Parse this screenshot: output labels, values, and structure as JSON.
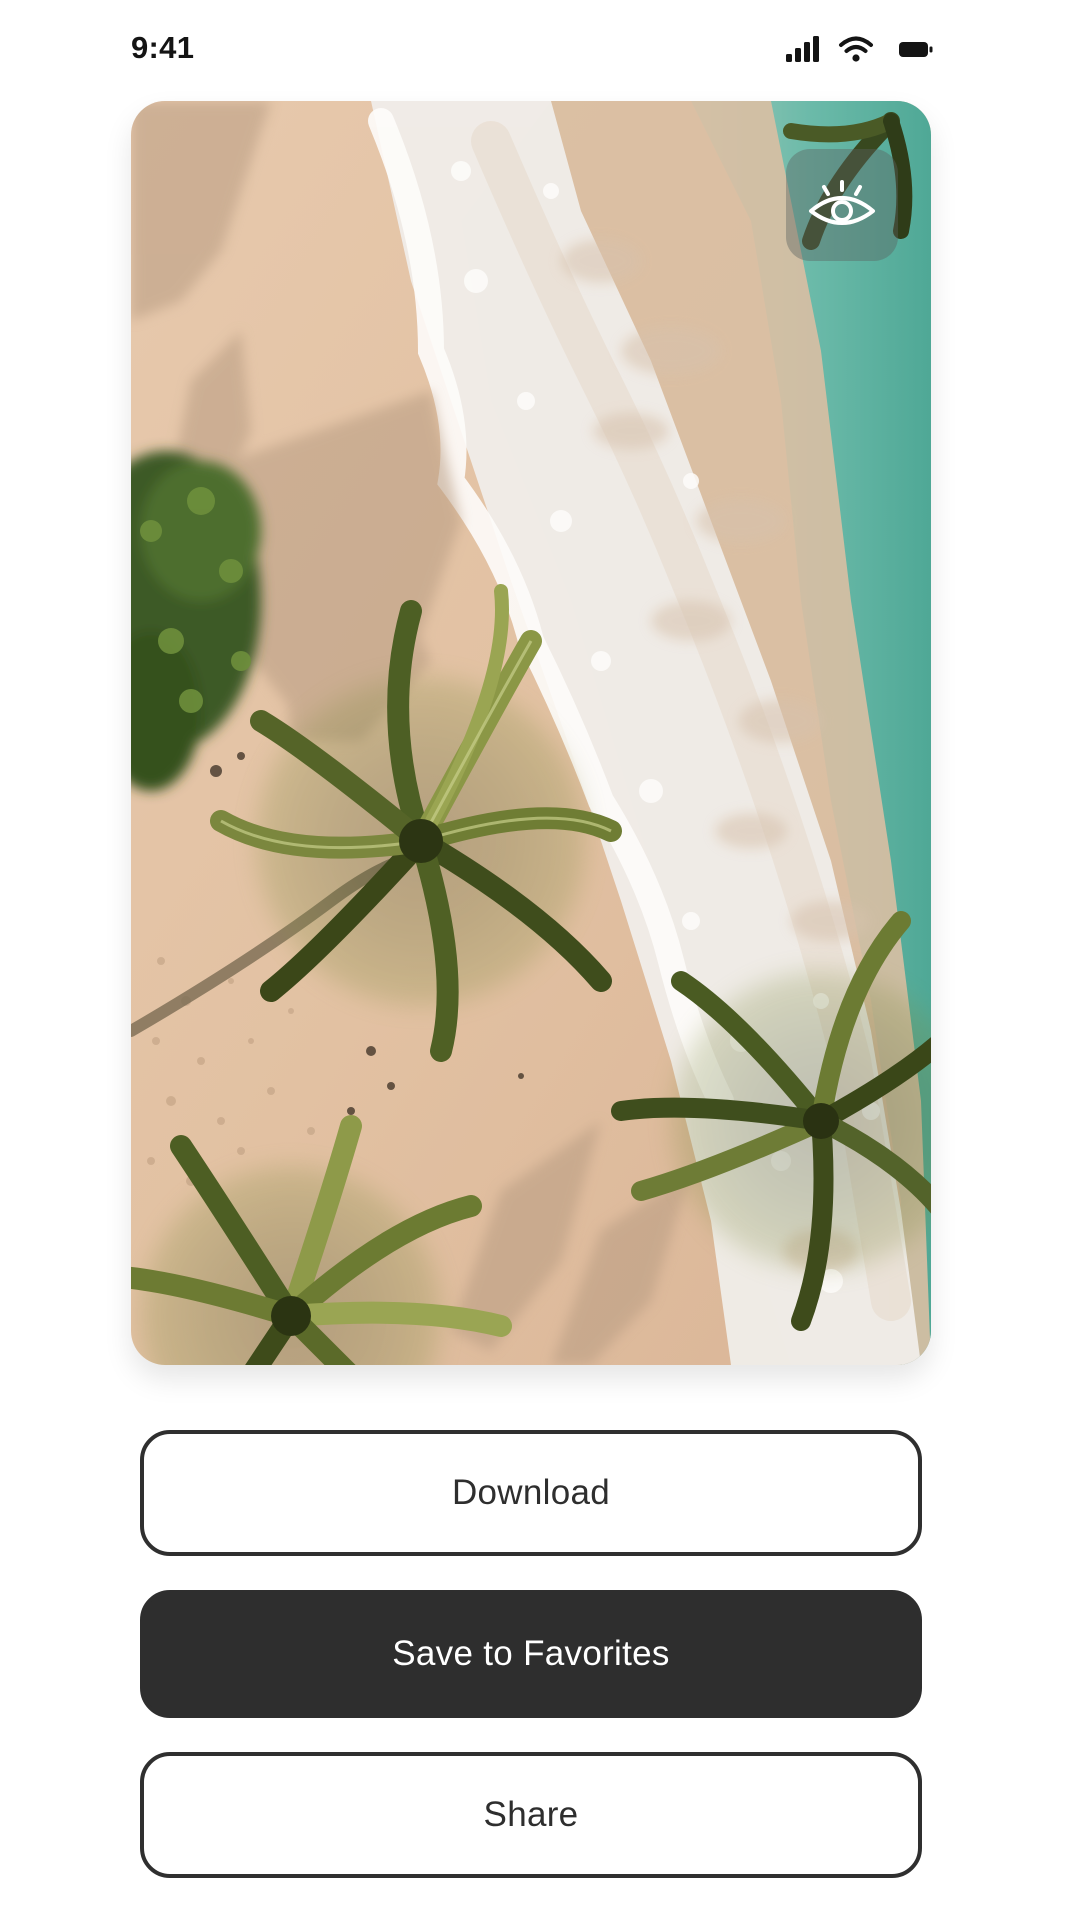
{
  "status_bar": {
    "time": "9:41",
    "icons": [
      "cellular-signal-icon",
      "wifi-icon",
      "battery-icon"
    ]
  },
  "photo": {
    "subject": "aerial-beach-photo",
    "overlay_icon": "eye-icon"
  },
  "actions": {
    "download_label": "Download",
    "save_label": "Save to Favorites",
    "share_label": "Share"
  },
  "colors": {
    "primary_button": "#2e2e2e",
    "outline_border": "#2f2f2f",
    "sand": "#e3c3a5",
    "foam": "#f3f1ee",
    "ocean": "#5fb3a4",
    "palm": "#5e6d2f"
  }
}
